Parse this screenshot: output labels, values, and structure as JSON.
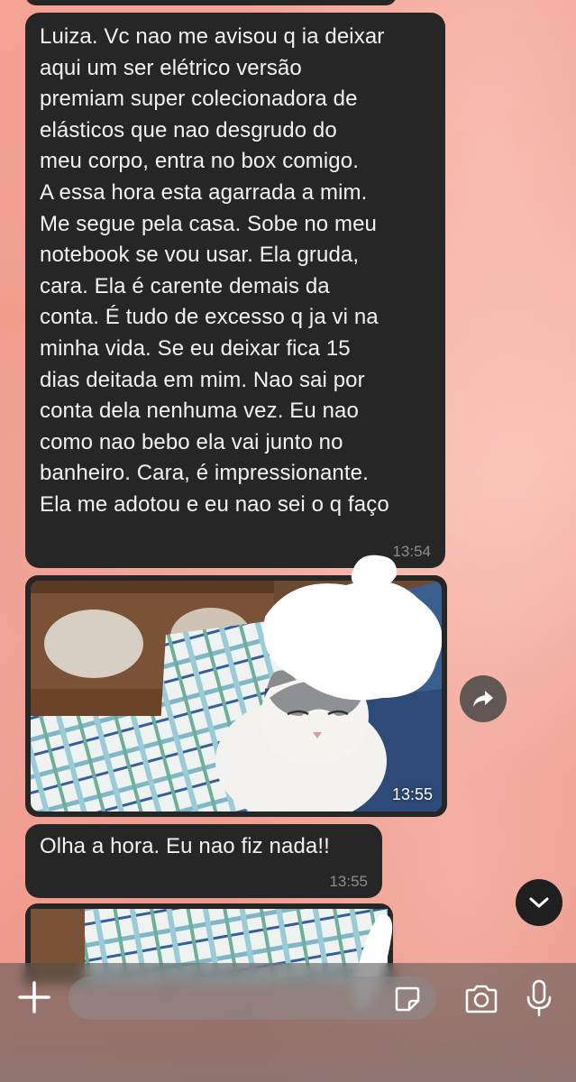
{
  "messages": [
    {
      "type": "text",
      "text": "Luiza. Vc nao me avisou q ia deixar\naqui um ser elétrico versão\npremiam super colecionadora de\nelásticos que nao desgrudo do\nmeu corpo,  entra no box comigo.\nA essa hora esta agarrada a mim.\nMe segue pela casa. Sobe no meu\nnotebook se vou usar. Ela gruda,\ncara. Ela é carente demais da\nconta. É tudo de excesso q ja vi na\nminha vida. Se eu deixar fica 15\ndias deitada em mim. Nao sai por\nconta dela nenhuma vez. Eu nao\ncomo nao bebo ela vai junto no\nbanheiro.  Cara, é impressionante.\nEla me adotou e eu nao sei o q faço",
      "time": "13:54"
    },
    {
      "type": "photo",
      "time": "13:55"
    },
    {
      "type": "text",
      "text": "Olha a hora.  Eu nao fiz nada!!",
      "time": "13:55"
    },
    {
      "type": "photo"
    }
  ],
  "input": {
    "placeholder": ""
  },
  "icons": {
    "forward": "forward-arrow-icon",
    "scroll_down": "chevron-down-icon",
    "add": "plus-icon",
    "sticker": "sticker-icon",
    "camera": "camera-icon",
    "mic": "microphone-icon"
  },
  "colors": {
    "bubble": "#262626",
    "wallpaper": "#f0a090",
    "bubble_text": "#f2f2f2",
    "timestamp": "#8e8e8e"
  }
}
